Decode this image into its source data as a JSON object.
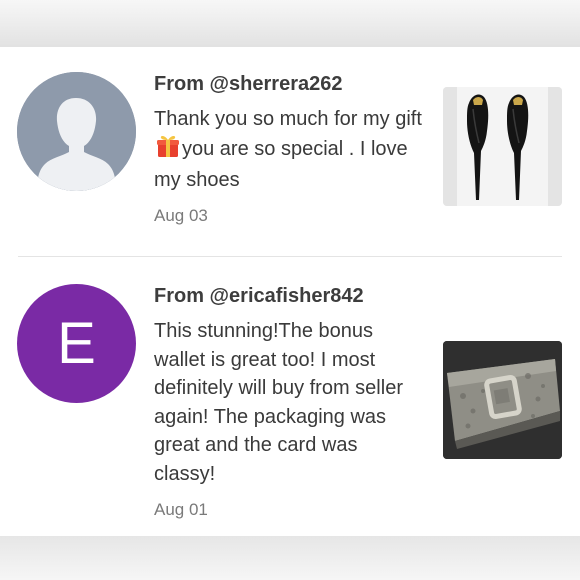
{
  "reviews": [
    {
      "from": "From @sherrera262",
      "comment_before_emoji": "Thank you so much for my gift",
      "emoji_icon": "wrapped-gift-icon",
      "comment_after_emoji": "you are so special . I love my shoes",
      "date": "Aug 03",
      "avatar_icon": "default-person-silhouette-icon",
      "product_icon": "black-high-heel-shoes-photo"
    },
    {
      "from": "From @ericafisher842",
      "comment": "This stunning!The bonus wallet is great too! I most definitely will buy from seller again! The packaging was great and the card was classy!",
      "date": "Aug 01",
      "avatar_initial": "E",
      "avatar_color": "#7a2aa5",
      "product_icon": "metallic-snakeskin-clutch-photo"
    }
  ],
  "colors": {
    "text": "#3a3a3a",
    "date": "#7a7a7a",
    "divider": "#e4e4e4",
    "default_avatar": "#8e9aab"
  }
}
